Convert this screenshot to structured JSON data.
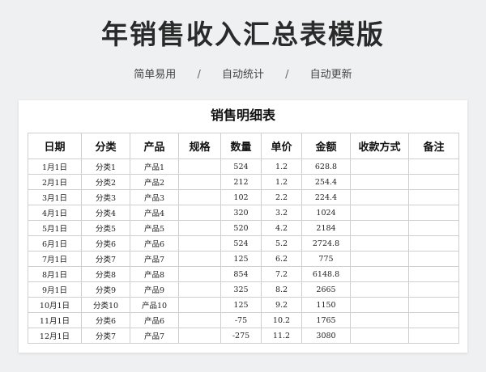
{
  "header": {
    "title": "年销售收入汇总表模版",
    "features": [
      "简单易用",
      "自动统计",
      "自动更新"
    ],
    "separator": "/"
  },
  "sheet": {
    "title": "销售明细表",
    "columns": [
      "日期",
      "分类",
      "产品",
      "规格",
      "数量",
      "单价",
      "金额",
      "收款方式",
      "备注"
    ],
    "rows": [
      [
        "1月1日",
        "分类1",
        "产品1",
        "",
        "524",
        "1.2",
        "628.8",
        "",
        ""
      ],
      [
        "2月1日",
        "分类2",
        "产品2",
        "",
        "212",
        "1.2",
        "254.4",
        "",
        ""
      ],
      [
        "3月1日",
        "分类3",
        "产品3",
        "",
        "102",
        "2.2",
        "224.4",
        "",
        ""
      ],
      [
        "4月1日",
        "分类4",
        "产品4",
        "",
        "320",
        "3.2",
        "1024",
        "",
        ""
      ],
      [
        "5月1日",
        "分类5",
        "产品5",
        "",
        "520",
        "4.2",
        "2184",
        "",
        ""
      ],
      [
        "6月1日",
        "分类6",
        "产品6",
        "",
        "524",
        "5.2",
        "2724.8",
        "",
        ""
      ],
      [
        "7月1日",
        "分类7",
        "产品7",
        "",
        "125",
        "6.2",
        "775",
        "",
        ""
      ],
      [
        "8月1日",
        "分类8",
        "产品8",
        "",
        "854",
        "7.2",
        "6148.8",
        "",
        ""
      ],
      [
        "9月1日",
        "分类9",
        "产品9",
        "",
        "325",
        "8.2",
        "2665",
        "",
        ""
      ],
      [
        "10月1日",
        "分类10",
        "产品10",
        "",
        "125",
        "9.2",
        "1150",
        "",
        ""
      ],
      [
        "11月1日",
        "分类6",
        "产品6",
        "",
        "-75",
        "10.2",
        "1765",
        "",
        ""
      ],
      [
        "12月1日",
        "分类7",
        "产品7",
        "",
        "-275",
        "11.2",
        "3080",
        "",
        ""
      ]
    ]
  }
}
